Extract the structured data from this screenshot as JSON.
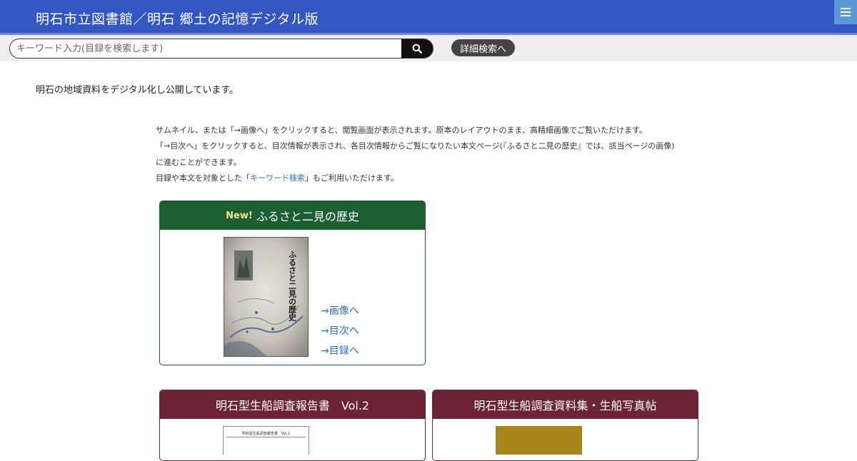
{
  "header": {
    "title": "明石市立図書館／明石 郷土の記憶デジタル版"
  },
  "search": {
    "placeholder": "キーワード入力(目録を検索します)",
    "advanced_label": "詳細検索へ"
  },
  "intro": "明石の地域資料をデジタル化し公開しています。",
  "info": {
    "line1": "サムネイル、または「→画像へ」をクリックすると、閲覧画面が表示されます。原本のレイアウトのまま、高精細画像でご覧いただけます。",
    "line2": "「→目次へ」をクリックすると、目次情報が表示され、各目次情報からご覧になりたい本文ページ(『ふるさと二見の歴史』では、該当ページの画像)",
    "line3": "に進むことができます。",
    "line4_before": "目録や本文を対象とした「",
    "line4_link": "キーワード検索",
    "line4_after": "」もご利用いただけます。"
  },
  "cards": [
    {
      "badge": "New!",
      "title": "ふるさと二見の歴史",
      "cover_text": "ふるさと二見の歴史",
      "links": [
        "→画像へ",
        "→目次へ",
        "→目録へ"
      ]
    },
    {
      "title": "明石型生船調査報告書　Vol.2",
      "thumb_title": "明石型生船調査報告書　Vol.2"
    },
    {
      "title": "明石型生船調査資料集・生船写真帖"
    }
  ],
  "colors": {
    "header": "#3456c2",
    "card_green": "#1b5e32",
    "card_red": "#6b2335",
    "link": "#2f6fc0"
  }
}
